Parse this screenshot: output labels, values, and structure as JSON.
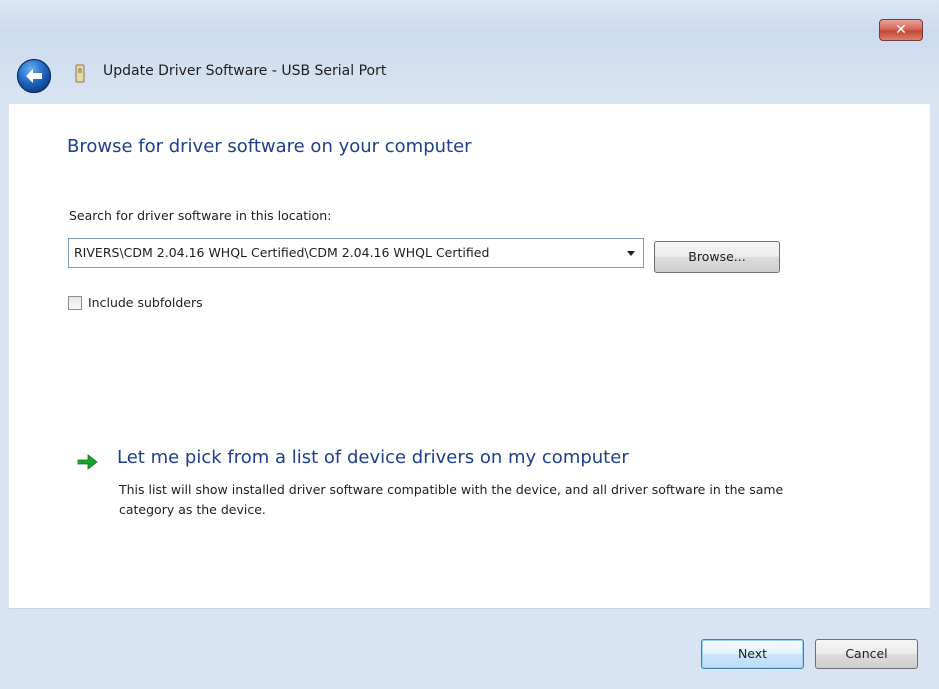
{
  "window": {
    "title": "Update Driver Software - USB Serial Port",
    "close_label": "✕"
  },
  "content": {
    "heading": "Browse for driver software on your computer",
    "search_label": "Search for driver software in this location:",
    "path_value": "RIVERS\\CDM 2.04.16 WHQL Certified\\CDM 2.04.16 WHQL Certified",
    "browse_label": "Browse...",
    "include_subfolders_label": "Include subfolders",
    "include_subfolders_checked": false,
    "pick_link_label": "Let me pick from a list of device drivers on my computer",
    "pick_description": "This list will show installed driver software compatible with the device, and all driver software in the same category as the device."
  },
  "footer": {
    "next_label": "Next",
    "cancel_label": "Cancel"
  },
  "icons": {
    "back": "back-arrow-icon",
    "device": "usb-device-icon",
    "combo": "chevron-down-icon",
    "link": "green-arrow-icon"
  },
  "colors": {
    "accent_text": "#1e3f8c",
    "link_arrow": "#1aa32a",
    "close_button": "#c44735"
  }
}
